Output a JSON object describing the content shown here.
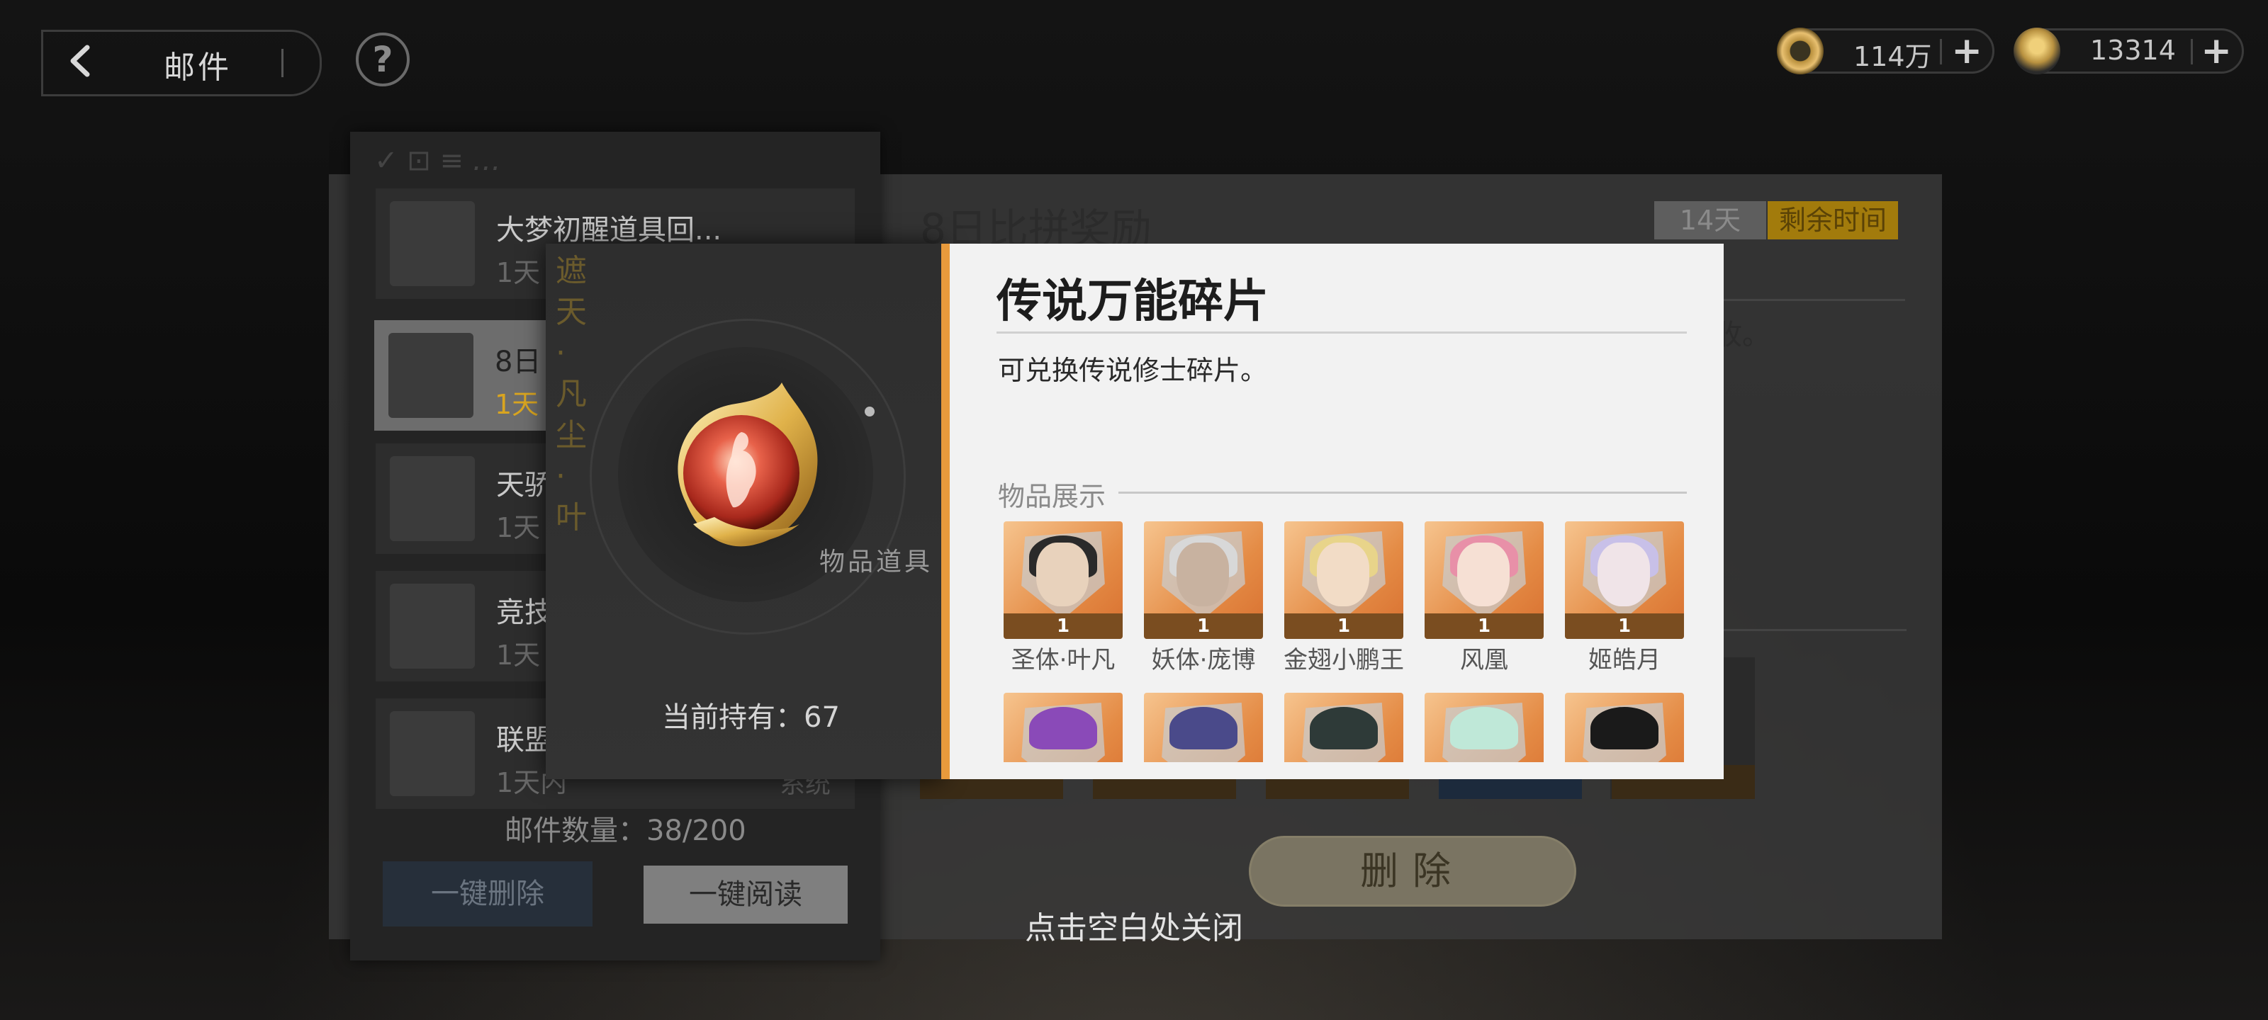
{
  "header": {
    "title": "邮件",
    "help_symbol": "?",
    "currencies": [
      {
        "icon": "coin-icon",
        "value": "114万"
      },
      {
        "icon": "gem-icon",
        "value": "13314"
      }
    ],
    "add_symbol": "+"
  },
  "mail_list": {
    "items": [
      {
        "title": "大梦初醒道具回...",
        "time": "1天",
        "source": ""
      },
      {
        "title": "8日",
        "time": "1天",
        "source": ""
      },
      {
        "title": "天骄",
        "time": "1天",
        "source": ""
      },
      {
        "title": "竞技",
        "time": "1天",
        "source": ""
      },
      {
        "title": "联盟",
        "time": "1天内",
        "source": "系统"
      }
    ],
    "count_label": "邮件数量：38/200",
    "delete_all_label": "一键删除",
    "read_all_label": "一键阅读"
  },
  "mail_detail": {
    "title": "8日比拼奖励",
    "days": "14天",
    "remaining_label": "剩余时间",
    "body_fragment": "收。",
    "delete_label": "删除"
  },
  "item_popup": {
    "vertical_text": "遮天·凡尘·叶",
    "art_label": "物品道具",
    "owned_label": "当前持有：67",
    "name": "传说万能碎片",
    "description": "可兑换传说修士碎片。",
    "showcase_label": "物品展示",
    "showcase": [
      {
        "name": "圣体·叶凡",
        "count": "1"
      },
      {
        "name": "妖体·庞博",
        "count": "1"
      },
      {
        "name": "金翅小鹏王",
        "count": "1"
      },
      {
        "name": "风凰",
        "count": "1"
      },
      {
        "name": "姬皓月",
        "count": "1"
      },
      {
        "name": "",
        "count": ""
      },
      {
        "name": "",
        "count": ""
      },
      {
        "name": "",
        "count": ""
      },
      {
        "name": "",
        "count": ""
      },
      {
        "name": "",
        "count": ""
      }
    ]
  },
  "close_hint": "点击空白处关闭",
  "colors": {
    "accent_orange": "#e89a3c",
    "gold": "#d9a520",
    "card_bg": "#e48b45"
  }
}
